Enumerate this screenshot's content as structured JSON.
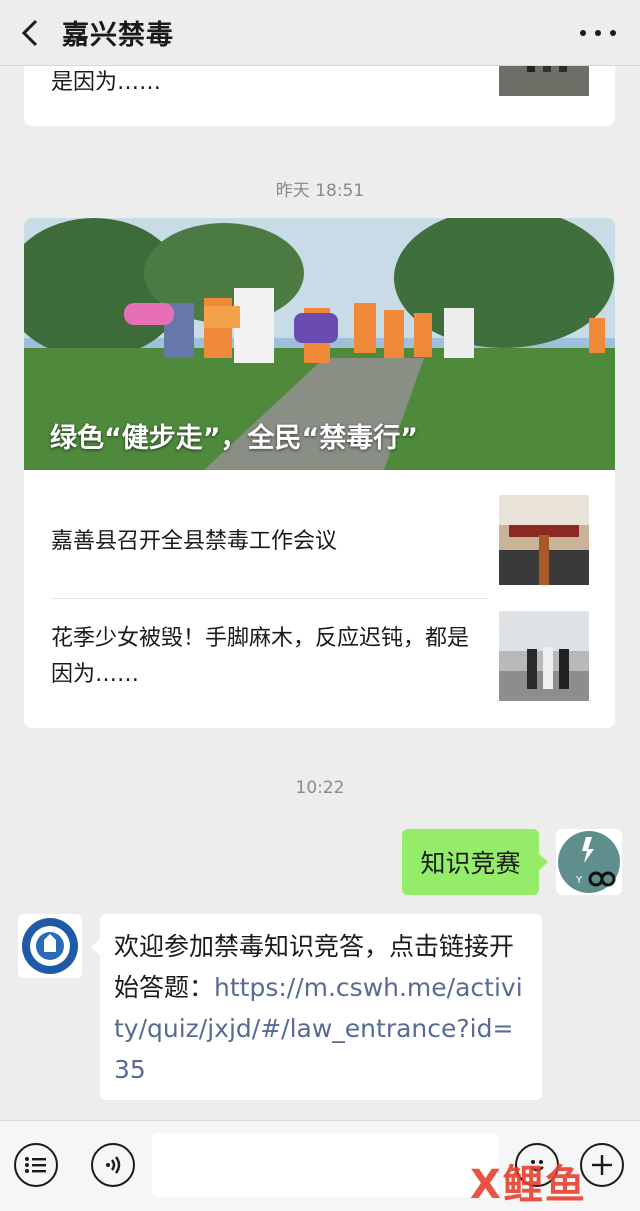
{
  "header": {
    "title": "嘉兴禁毒"
  },
  "top_card": {
    "text": "是因为……"
  },
  "timestamps": {
    "yesterday": "昨天 18:51",
    "today": "10:22"
  },
  "article": {
    "cover_title": "绿色“健步走”，全民“禁毒行”",
    "items": [
      {
        "title": "嘉善县召开全县禁毒工作会议"
      },
      {
        "title": "花季少女被毁！手脚麻木，反应迟钝，都是因为……"
      }
    ]
  },
  "chat": {
    "me_message": "知识竞赛",
    "bot_message_text": "欢迎参加禁毒知识竞答，点击链接开始答题：",
    "bot_message_link": "https://m.cswh.me/activity/quiz/jxjd/#/law_entrance?id=35"
  },
  "watermark": "X鲤鱼",
  "colors": {
    "my_bubble": "#95ec69",
    "link": "#576b95",
    "background": "#ededed",
    "watermark": "#e8402f"
  },
  "icons": {
    "back": "chevron-left-icon",
    "more": "more-dots-icon",
    "menu": "list-icon",
    "voice": "voice-icon",
    "emoji": "emoji-icon",
    "plus": "plus-icon"
  }
}
